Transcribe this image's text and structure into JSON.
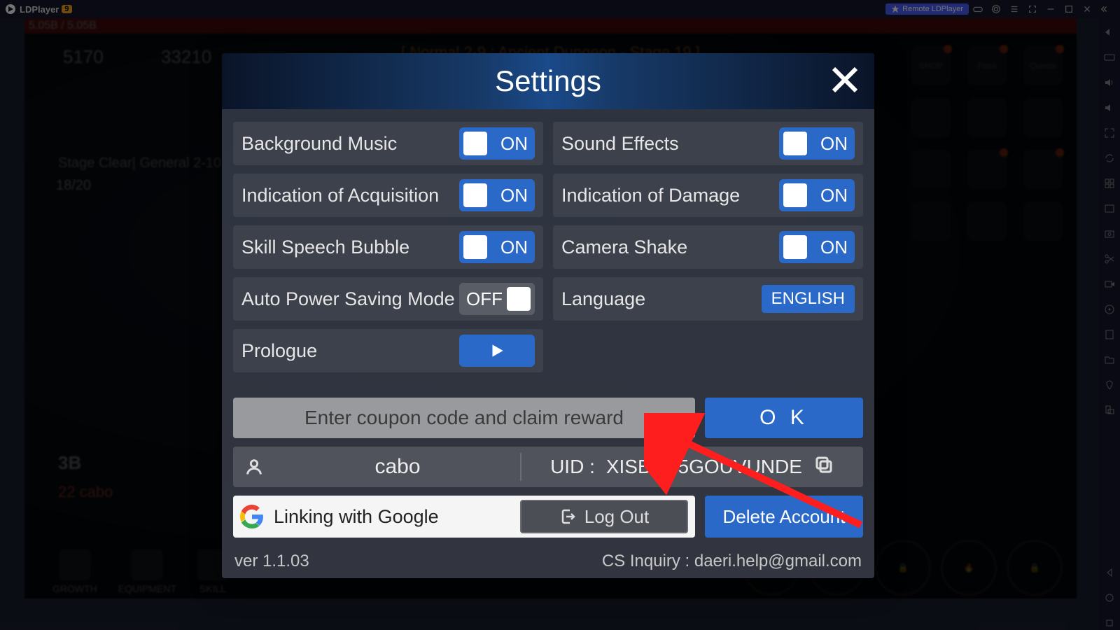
{
  "titlebar": {
    "brand": "LDPlayer",
    "brand_badge": "9",
    "remote_label": "Remote LDPlayer"
  },
  "game_bg": {
    "top_banner": "[ Normal 2-9 : Ancient Dungeon - Stage 19 ]",
    "currency1": "5170",
    "currency2": "33210",
    "stage_clear": "Stage Clear| General 2-10",
    "progress": "18/20",
    "b_label": "3B",
    "player_line": "22  cabo",
    "hp": "5.05B / 5.05B",
    "tabs": [
      "GROWTH",
      "EQUIPMENT",
      "SKILL"
    ],
    "right_top": [
      "SHOP",
      "Pass",
      "Quests"
    ]
  },
  "settings": {
    "title": "Settings",
    "rows": {
      "bgm": {
        "label": "Background Music",
        "state": "ON"
      },
      "sfx": {
        "label": "Sound Effects",
        "state": "ON"
      },
      "acquisition": {
        "label": "Indication of Acquisition",
        "state": "ON"
      },
      "damage": {
        "label": "Indication of Damage",
        "state": "ON"
      },
      "skill_bubble": {
        "label": "Skill Speech Bubble",
        "state": "ON"
      },
      "camera_shake": {
        "label": "Camera Shake",
        "state": "ON"
      },
      "power_save": {
        "label": "Auto Power Saving Mode",
        "state": "OFF"
      },
      "language": {
        "label": "Language",
        "value": "ENGLISH"
      },
      "prologue": {
        "label": "Prologue"
      }
    },
    "coupon_placeholder": "Enter coupon code and claim reward",
    "ok": "O K",
    "user": {
      "name": "cabo",
      "uid_prefix": "UID : ",
      "uid": "XISBKN5GOUVUNDE"
    },
    "google_link": "Linking with Google",
    "logout": "Log Out",
    "delete": "Delete Account",
    "version": "ver 1.1.03",
    "cs_inquiry": "CS Inquiry : daeri.help@gmail.com"
  }
}
